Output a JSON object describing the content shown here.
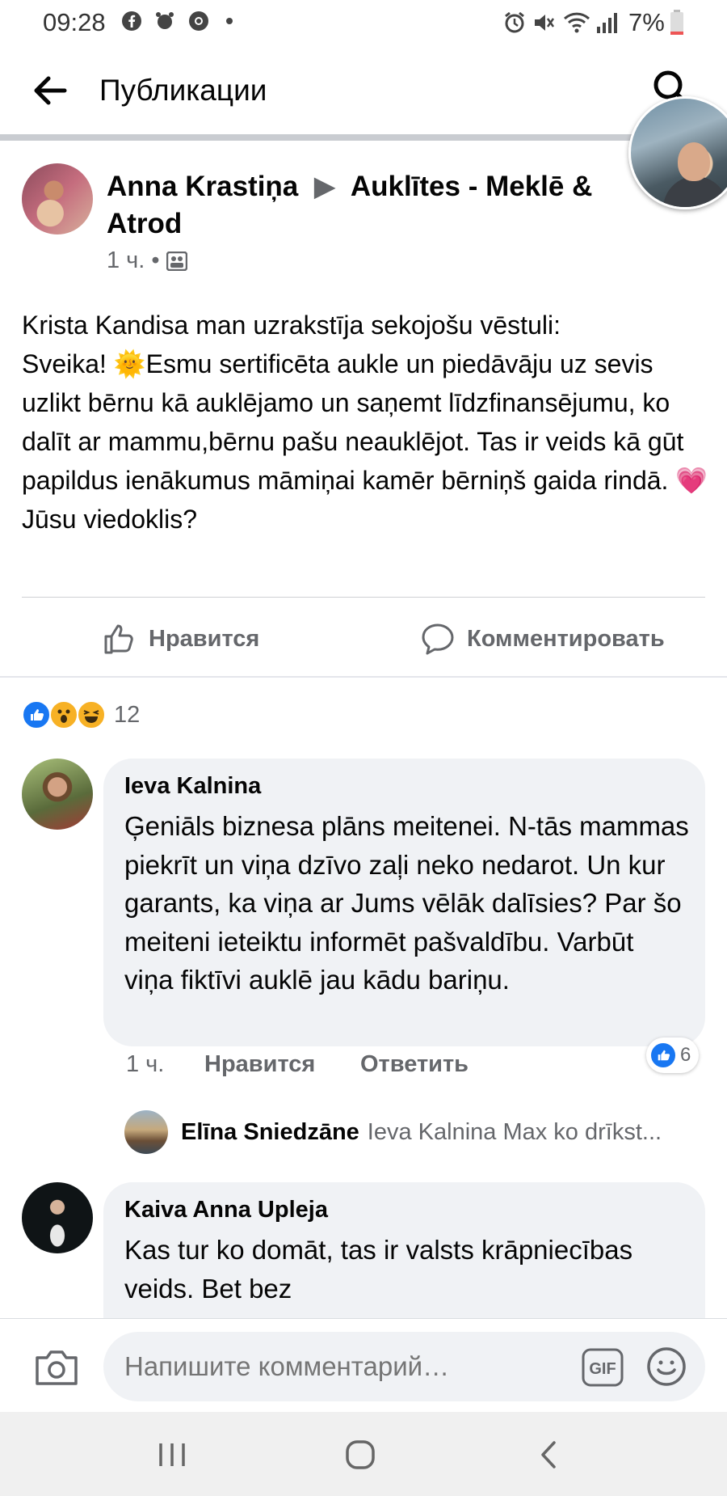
{
  "status_bar": {
    "time": "09:28",
    "battery": "7%"
  },
  "topbar": {
    "title": "Публикации"
  },
  "post": {
    "author": "Anna Krastiņa",
    "group": "Auklītes - Meklē & Atrod",
    "time": "1 ч.",
    "text": "Krista Kandisa man uzrakstīja sekojošu vēstuli:\nSveika! 🌞Esmu sertificēta aukle un piedāvāju uz sevis uzlikt bērnu kā auklējamo un saņemt līdzfinansējumu, ko dalīt ar mammu,bērnu pašu neauklējot. Tas ir veids kā gūt papildus ienākumus māmiņai kamēr bērniņš gaida rindā. 💗\nJūsu viedoklis?",
    "like_label": "Нравится",
    "comment_label": "Комментировать",
    "reaction_count": "12"
  },
  "comments": [
    {
      "author": "Ieva Kalnina",
      "text": "Ģeniāls biznesa plāns meitenei. N-tās mammas piekrīt un viņa dzīvo zaļi neko nedarot. Un kur garants, ka viņa ar Jums vēlāk dalīsies? Par šo meiteni ieteiktu informēt pašvaldību. Varbūt viņa fiktīvi auklē jau kādu bariņu.",
      "time": "1 ч.",
      "like_label": "Нравится",
      "reply_label": "Ответить",
      "reaction_count": "6",
      "reply": {
        "author": "Elīna Sniedzāne",
        "text": "Ieva Kalnina Max ko drīkst..."
      }
    },
    {
      "author": "Kaiva Anna Upleja",
      "text": "Kas tur ko domāt, tas ir valsts krāpniecības veids. Bet bez"
    }
  ],
  "composer": {
    "placeholder": "Напишите комментарий…",
    "gif_label": "GIF"
  },
  "icons": {
    "back": "arrow-left-icon",
    "search": "search-icon",
    "camera": "camera-icon",
    "gif": "gif-icon",
    "emoji": "smiley-icon",
    "like": "thumbs-up-icon",
    "comment": "speech-bubble-icon"
  },
  "colors": {
    "brand_blue": "#1877f2",
    "secondary_text": "#65676b",
    "bubble_bg": "#f0f2f5"
  }
}
